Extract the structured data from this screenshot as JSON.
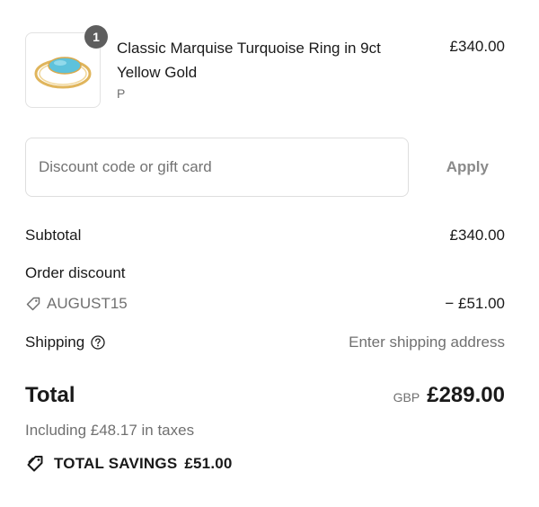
{
  "item": {
    "quantity": "1",
    "title": "Classic Marquise Turquoise Ring in 9ct Yellow Gold",
    "variant": "P",
    "price": "£340.00",
    "image_icon": "turquoise-ring"
  },
  "discount": {
    "placeholder": "Discount code or gift card",
    "value": "",
    "apply_label": "Apply"
  },
  "summary": {
    "subtotal_label": "Subtotal",
    "subtotal_value": "£340.00",
    "order_discount_label": "Order discount",
    "discount_code": "AUGUST15",
    "discount_value": "− £51.00",
    "shipping_label": "Shipping",
    "shipping_value": "Enter shipping address"
  },
  "total": {
    "label": "Total",
    "currency": "GBP",
    "amount": "£289.00",
    "taxes_note": "Including £48.17 in taxes"
  },
  "savings": {
    "label": "TOTAL SAVINGS",
    "amount": "£51.00"
  },
  "colors": {
    "text": "#1a1a1a",
    "muted": "#707070",
    "border": "#dedede",
    "badge": "#5e5e5e",
    "turquoise": "#63c6df",
    "gold": "#e0b55c"
  }
}
